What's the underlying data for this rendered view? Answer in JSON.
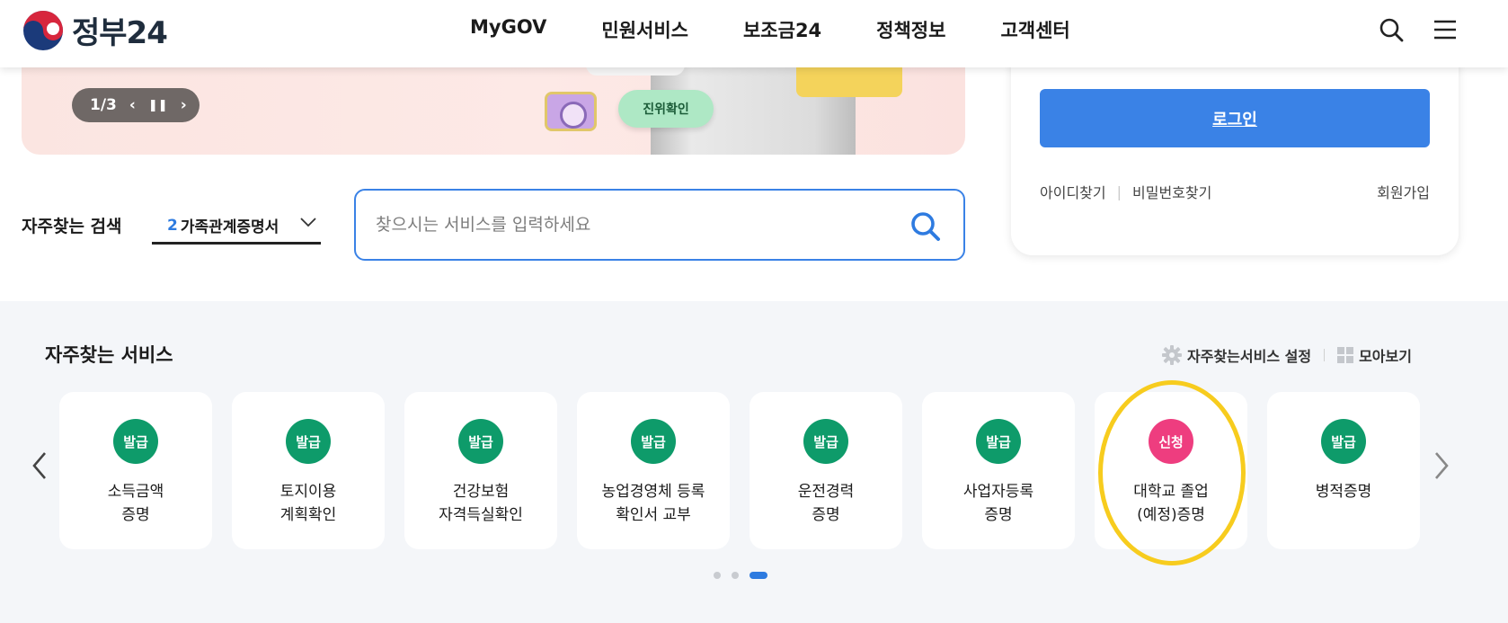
{
  "header": {
    "logo_text": "정부24",
    "nav": [
      "MyGOV",
      "민원서비스",
      "보조금24",
      "정책정보",
      "고객센터"
    ]
  },
  "banner": {
    "page_indicator": "1/3",
    "chip_text": "진위확인"
  },
  "login": {
    "button_label": "로그인",
    "find_id": "아이디찾기",
    "find_password": "비밀번호찾기",
    "signup": "회원가입"
  },
  "search": {
    "label": "자주찾는 검색",
    "selected_rank": "2",
    "selected_term": "가족관계증명서",
    "placeholder": "찾으시는 서비스를 입력하세요"
  },
  "services": {
    "title": "자주찾는 서비스",
    "settings_label": "자주찾는서비스 설정",
    "view_all_label": "모아보기",
    "items": [
      {
        "badge": "발급",
        "label": "소득금액\n증명",
        "type": "issue"
      },
      {
        "badge": "발급",
        "label": "토지이용\n계획확인",
        "type": "issue"
      },
      {
        "badge": "발급",
        "label": "건강보험\n자격득실확인",
        "type": "issue"
      },
      {
        "badge": "발급",
        "label": "농업경영체 등록\n확인서 교부",
        "type": "issue"
      },
      {
        "badge": "발급",
        "label": "운전경력\n증명",
        "type": "issue"
      },
      {
        "badge": "발급",
        "label": "사업자등록\n증명",
        "type": "issue"
      },
      {
        "badge": "신청",
        "label": "대학교 졸업\n(예정)증명",
        "type": "apply"
      },
      {
        "badge": "발급",
        "label": "병적증명",
        "type": "issue"
      }
    ],
    "pagination": {
      "total": 3,
      "current": 3
    }
  },
  "colors": {
    "primary": "#3a82e6",
    "issue_badge": "#0e9b6a",
    "apply_badge": "#ee3d7f",
    "highlight": "#f7cc1e"
  }
}
